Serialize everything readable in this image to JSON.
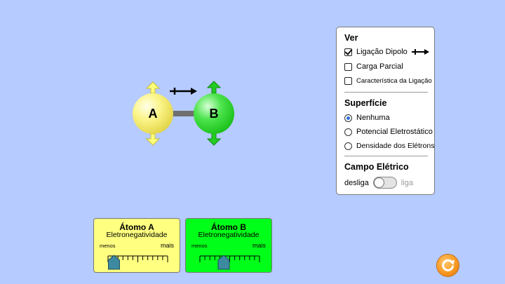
{
  "molecule": {
    "atom_a_label": "A",
    "atom_b_label": "B",
    "atom_a_color": "#f5ee6a",
    "atom_b_color": "#22cc22"
  },
  "panel": {
    "view_title": "Ver",
    "bond_dipole": {
      "label": "Ligação Dipolo",
      "checked": true
    },
    "partial_charge": {
      "label": "Carga Parcial",
      "checked": false
    },
    "bond_character": {
      "label": "Característica da Ligação",
      "checked": false
    },
    "surface_title": "Superfície",
    "surface_options": [
      {
        "label": "Nenhuma",
        "selected": true
      },
      {
        "label": "Potencial Eletrostático",
        "selected": false
      },
      {
        "label": "Densidade dos Elétrons",
        "selected": false
      }
    ],
    "efield_title": "Campo Elétrico",
    "efield_off": "desliga",
    "efield_on": "liga",
    "efield_enabled": false
  },
  "atom_a_panel": {
    "title": "Átomo A",
    "subtitle": "Eletronegatividade",
    "less": "menos",
    "more": "mais",
    "value_fraction": 0.1,
    "color": "#ffff80"
  },
  "atom_b_panel": {
    "title": "Átomo B",
    "subtitle": "Eletronegatividade",
    "less": "menos",
    "more": "mais",
    "value_fraction": 0.4,
    "color": "#00ff19"
  },
  "icons": {
    "reset": "reset-icon",
    "dipole": "dipole-arrow-icon"
  }
}
